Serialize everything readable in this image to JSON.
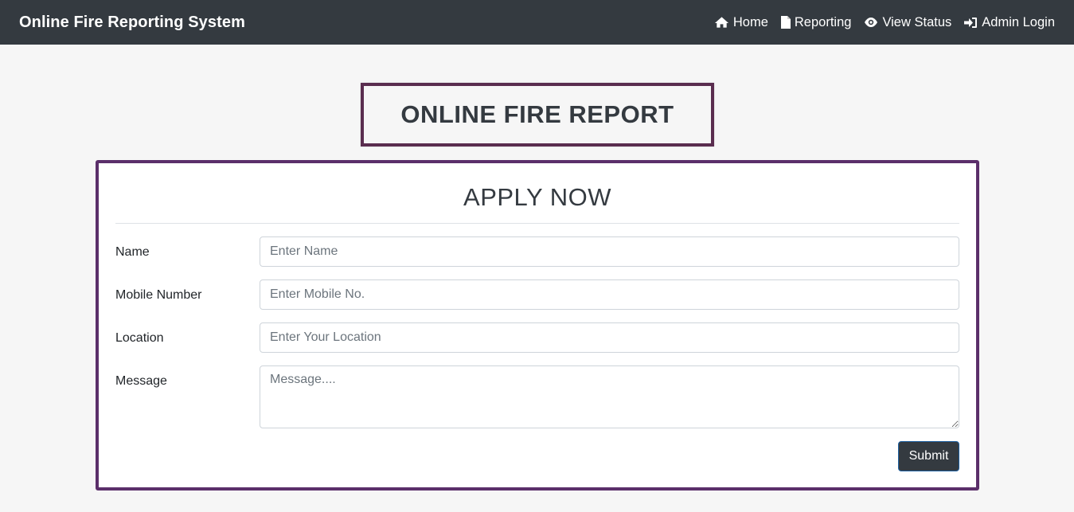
{
  "navbar": {
    "brand": "Online Fire Reporting System",
    "links": [
      {
        "label": "Home",
        "icon": "home-icon"
      },
      {
        "label": "Reporting",
        "icon": "file-icon"
      },
      {
        "label": "View Status",
        "icon": "eye-icon"
      },
      {
        "label": "Admin Login",
        "icon": "sign-in-icon"
      }
    ]
  },
  "page_title": "ONLINE FIRE REPORT",
  "form": {
    "heading": "APPLY NOW",
    "fields": [
      {
        "label": "Name",
        "placeholder": "Enter Name",
        "value": ""
      },
      {
        "label": "Mobile Number",
        "placeholder": "Enter Mobile No.",
        "value": ""
      },
      {
        "label": "Location",
        "placeholder": "Enter Your Location",
        "value": ""
      },
      {
        "label": "Message",
        "placeholder": "Message....",
        "value": ""
      }
    ],
    "submit_label": "Submit"
  },
  "colors": {
    "navbar_bg": "#343a40",
    "title_border": "#5a2d4f",
    "card_border": "#5b2f6a",
    "background": "#f6f6f6"
  }
}
